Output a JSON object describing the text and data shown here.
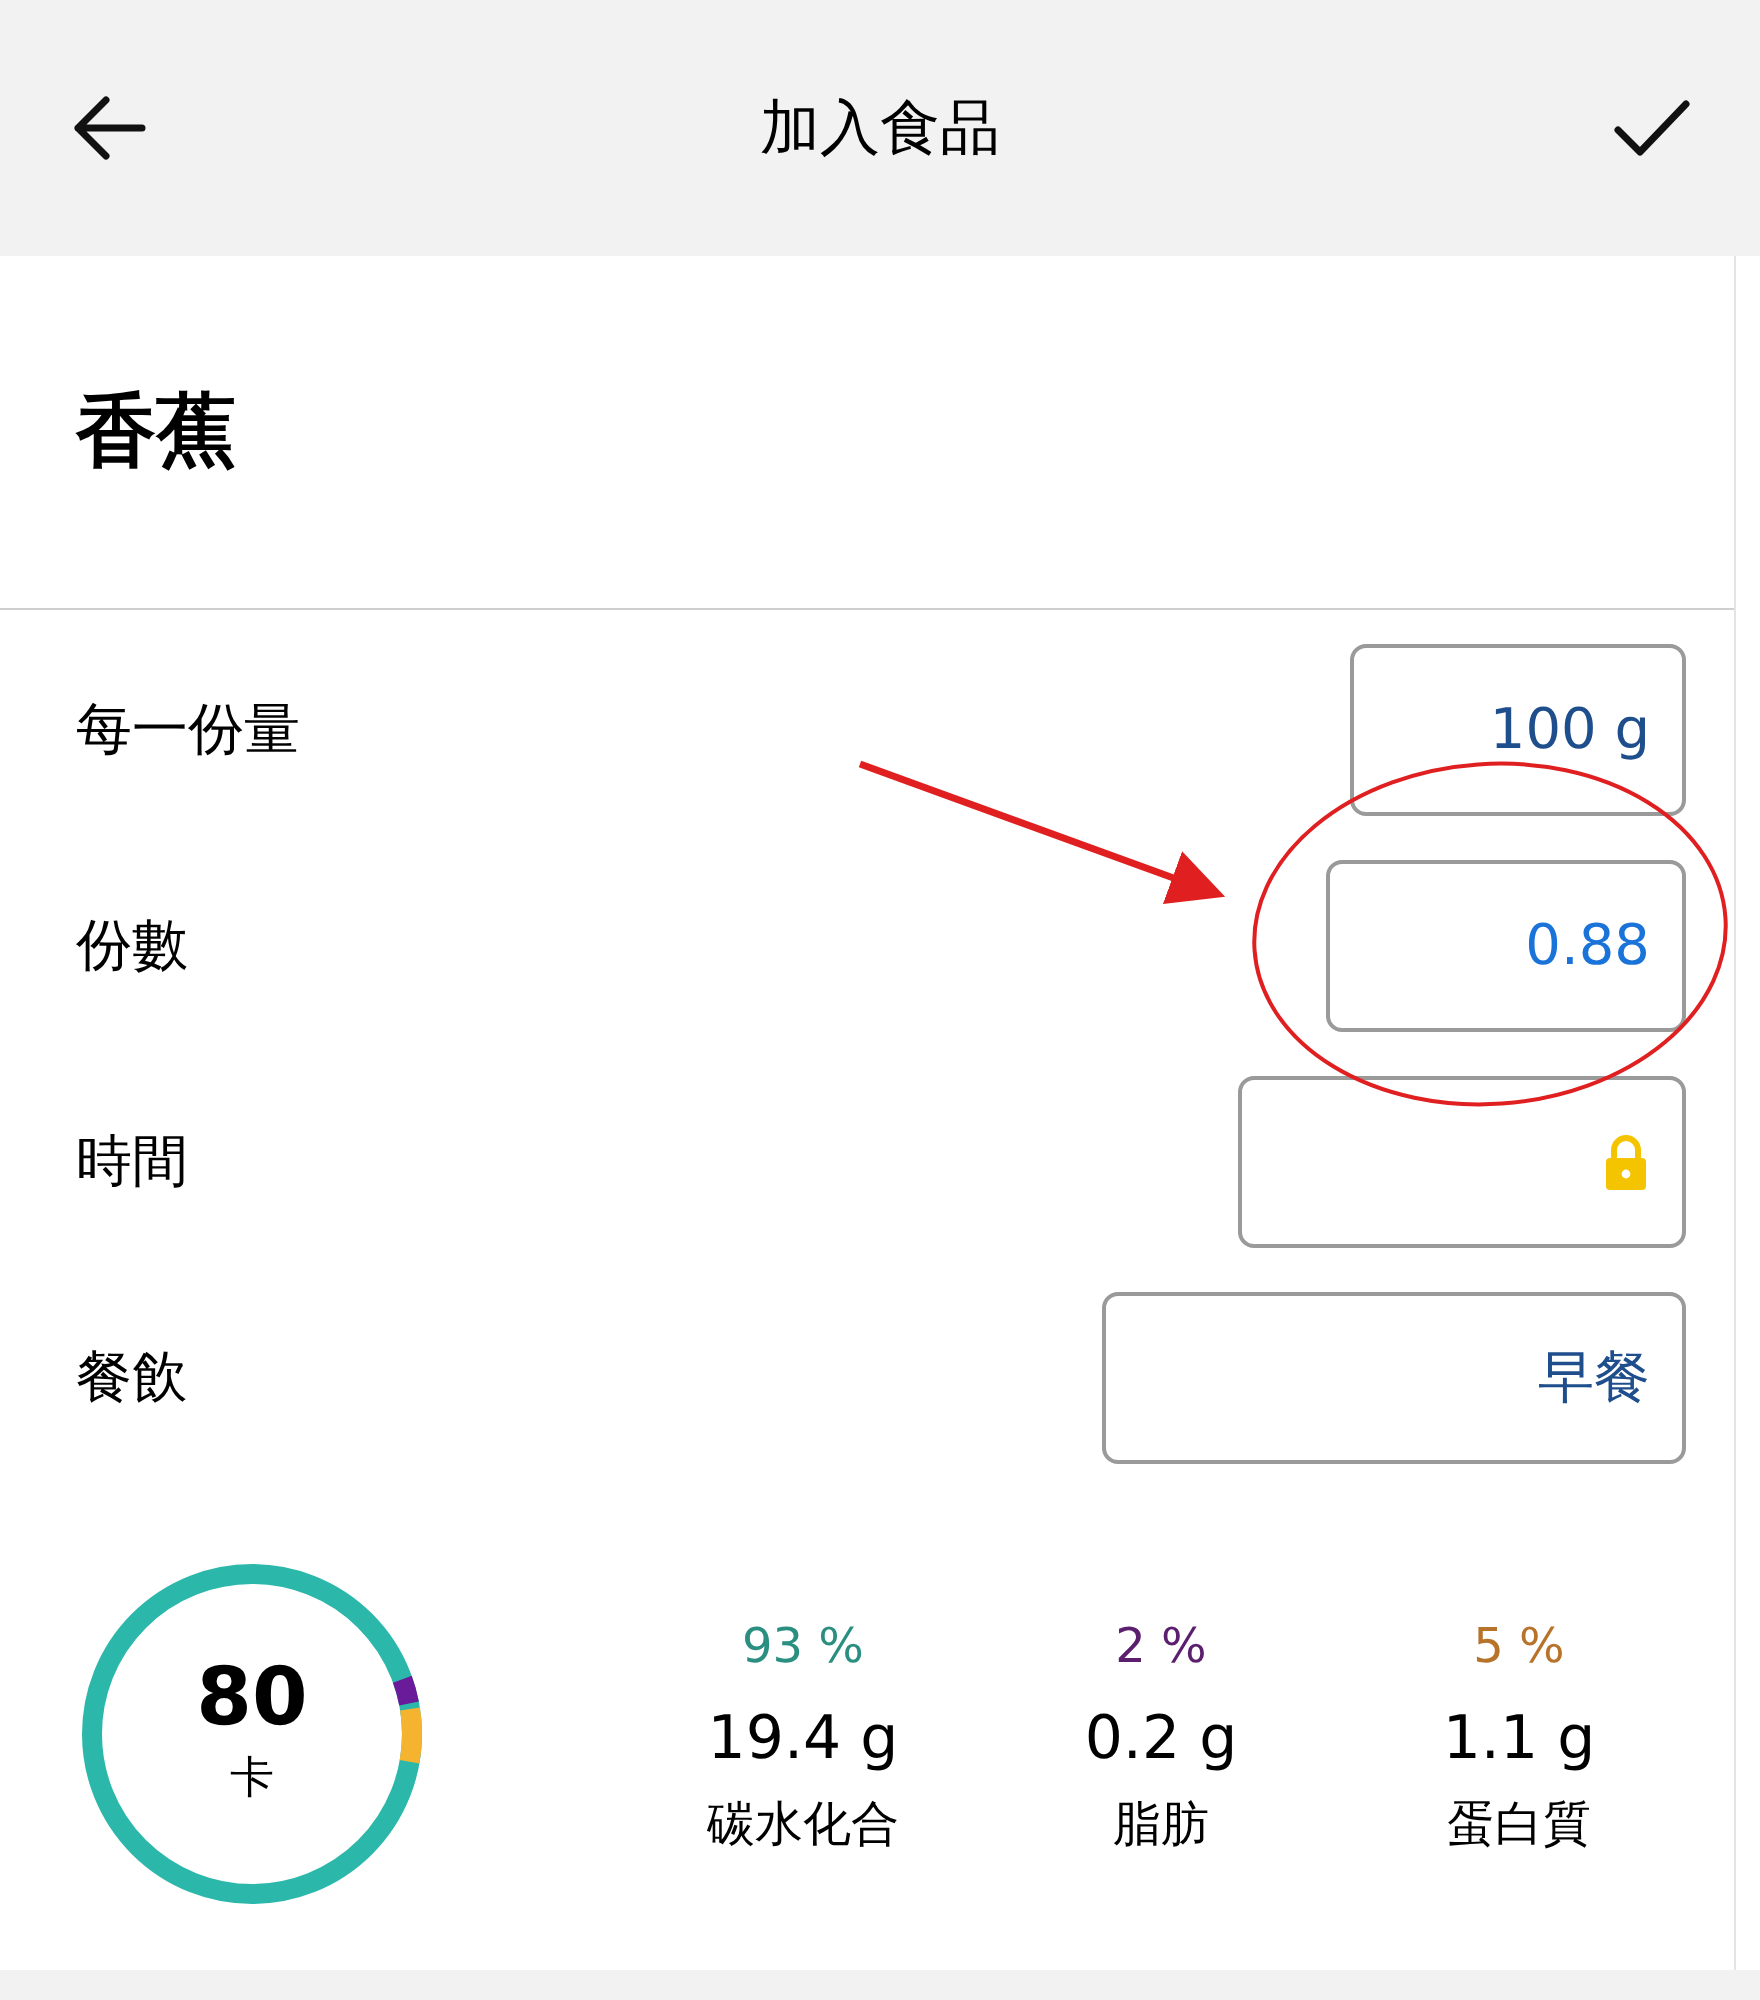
{
  "header": {
    "title": "加入食品"
  },
  "food": {
    "name": "香蕉"
  },
  "fields": [
    {
      "kind": "text",
      "label": "每一份量",
      "value": "100 g"
    },
    {
      "kind": "text",
      "label": "份數",
      "value": "0.88"
    },
    {
      "kind": "locked",
      "label": "時間"
    },
    {
      "kind": "text",
      "label": "餐飲",
      "value": "早餐"
    }
  ],
  "calories": {
    "value": "80",
    "unit": "卡"
  },
  "macros": [
    {
      "percent": "93 %",
      "amount": "19.4 g",
      "name": "碳水化合",
      "color": "#2a8f80"
    },
    {
      "percent": "2 %",
      "amount": "0.2 g",
      "name": "脂肪",
      "color": "#5b1f6e"
    },
    {
      "percent": "5 %",
      "amount": "1.1 g",
      "name": "蛋白質",
      "color": "#b8732a"
    }
  ]
}
